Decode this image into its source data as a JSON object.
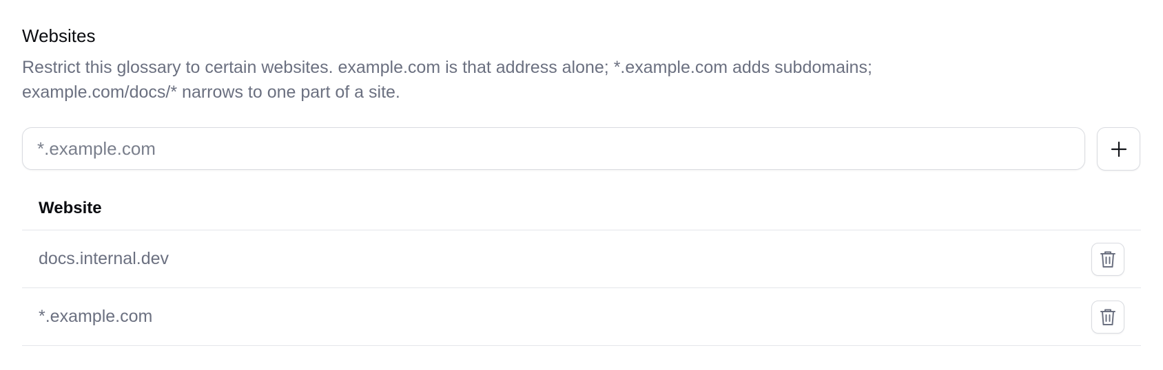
{
  "section": {
    "title": "Websites",
    "description": "Restrict this glossary to certain websites. example.com is that address alone; *.example.com adds subdomains; example.com/docs/* narrows to one part of a site."
  },
  "input": {
    "value": "",
    "placeholder": "*.example.com",
    "add_icon": "plus-icon"
  },
  "table": {
    "header": "Website",
    "rows": [
      {
        "website": "docs.internal.dev",
        "action_icon": "trash-icon"
      },
      {
        "website": "*.example.com",
        "action_icon": "trash-icon"
      }
    ]
  },
  "colors": {
    "text_primary": "#0b0c10",
    "text_muted": "#6b7080",
    "border": "#d9dbe0",
    "divider": "#e4e6ea"
  }
}
